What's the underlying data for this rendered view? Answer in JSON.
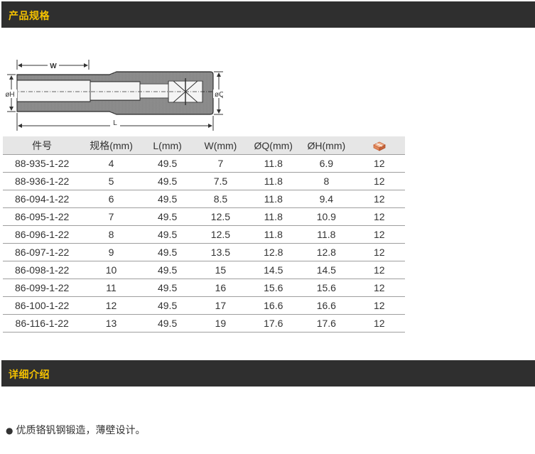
{
  "sections": {
    "spec_title": "产品规格",
    "detail_title": "详细介绍"
  },
  "diagram": {
    "label_w": "W",
    "label_h": "øH",
    "label_q": "øQ",
    "label_l": "L"
  },
  "table": {
    "headers": [
      "件号",
      "规格(mm)",
      "L(mm)",
      "W(mm)",
      "ØQ(mm)",
      "ØH(mm)"
    ],
    "qty_header_icon": "package-icon",
    "rows": [
      [
        "88-935-1-22",
        "4",
        "49.5",
        "7",
        "11.8",
        "6.9",
        "12"
      ],
      [
        "88-936-1-22",
        "5",
        "49.5",
        "7.5",
        "11.8",
        "8",
        "12"
      ],
      [
        "86-094-1-22",
        "6",
        "49.5",
        "8.5",
        "11.8",
        "9.4",
        "12"
      ],
      [
        "86-095-1-22",
        "7",
        "49.5",
        "12.5",
        "11.8",
        "10.9",
        "12"
      ],
      [
        "86-096-1-22",
        "8",
        "49.5",
        "12.5",
        "11.8",
        "11.8",
        "12"
      ],
      [
        "86-097-1-22",
        "9",
        "49.5",
        "13.5",
        "12.8",
        "12.8",
        "12"
      ],
      [
        "86-098-1-22",
        "10",
        "49.5",
        "15",
        "14.5",
        "14.5",
        "12"
      ],
      [
        "86-099-1-22",
        "11",
        "49.5",
        "16",
        "15.6",
        "15.6",
        "12"
      ],
      [
        "86-100-1-22",
        "12",
        "49.5",
        "17",
        "16.6",
        "16.6",
        "12"
      ],
      [
        "86-116-1-22",
        "13",
        "49.5",
        "19",
        "17.6",
        "17.6",
        "12"
      ]
    ]
  },
  "description": {
    "bullet": "●",
    "text": "优质铬钒钢锻造，薄壁设计。"
  },
  "colors": {
    "bar_bg": "#2f2f2f",
    "bar_text": "#f5c200",
    "header_bg": "#e6e6e6",
    "row_border": "#9e9e9e"
  }
}
